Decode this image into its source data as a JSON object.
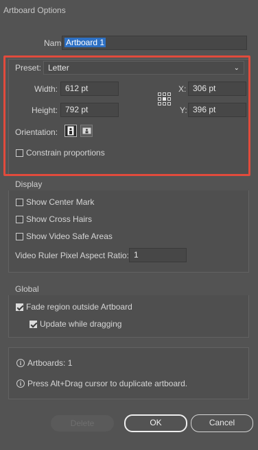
{
  "window": {
    "title": "Artboard Options"
  },
  "name": {
    "label": "Name:",
    "value": "Artboard 1"
  },
  "preset": {
    "label": "Preset:",
    "value": "Letter"
  },
  "size": {
    "width_label": "Width:",
    "width_value": "612 pt",
    "height_label": "Height:",
    "height_value": "792 pt"
  },
  "position": {
    "x_label": "X:",
    "x_value": "306 pt",
    "y_label": "Y:",
    "y_value": "396 pt"
  },
  "orientation": {
    "label": "Orientation:",
    "selected": "portrait"
  },
  "constrain": {
    "label": "Constrain proportions",
    "checked": false
  },
  "display": {
    "title": "Display",
    "show_center_mark": "Show Center Mark",
    "show_cross_hairs": "Show Cross Hairs",
    "show_video_safe_areas": "Show Video Safe Areas",
    "pixel_ratio_label": "Video Ruler Pixel Aspect Ratio:",
    "pixel_ratio_value": "1"
  },
  "global": {
    "title": "Global",
    "fade_region": "Fade region outside Artboard",
    "update_dragging": "Update while dragging"
  },
  "info": {
    "artboards": "Artboards: 1",
    "hint": "Press Alt+Drag cursor to duplicate artboard."
  },
  "buttons": {
    "delete": "Delete",
    "ok": "OK",
    "cancel": "Cancel"
  },
  "colors": {
    "background": "#535353",
    "highlight": "#e24b3c",
    "selection": "#2d70c4"
  }
}
